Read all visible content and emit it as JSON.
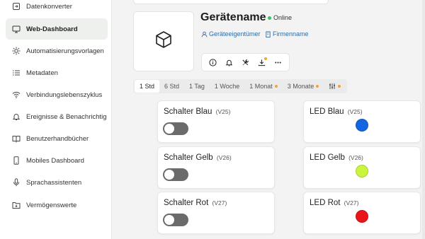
{
  "sidebar": {
    "items": [
      {
        "label": "Datenkonverter",
        "icon": "convert-icon",
        "active": false
      },
      {
        "label": "Web-Dashboard",
        "icon": "dashboard-icon",
        "active": true
      },
      {
        "label": "Automatisierungsvorlagen",
        "icon": "automation-icon",
        "active": false
      },
      {
        "label": "Metadaten",
        "icon": "list-icon",
        "active": false
      },
      {
        "label": "Verbindungslebenszyklus",
        "icon": "wifi-icon",
        "active": false
      },
      {
        "label": "Ereignisse & Benachrichtig",
        "icon": "bell-icon",
        "active": false
      },
      {
        "label": "Benutzerhandbücher",
        "icon": "book-icon",
        "active": false
      },
      {
        "label": "Mobiles Dashboard",
        "icon": "phone-icon",
        "active": false
      },
      {
        "label": "Sprachassistenten",
        "icon": "microphone-icon",
        "active": false
      },
      {
        "label": "Vermögenswerte",
        "icon": "folder-icon",
        "active": false
      }
    ]
  },
  "device": {
    "name": "Gerätename",
    "status": "Online",
    "owner_link": "Geräteeigentümer",
    "company_link": "Firmenname",
    "image_icon": "cube-icon"
  },
  "actions": [
    {
      "icon": "info-icon",
      "badge": false
    },
    {
      "icon": "bell-icon",
      "badge": false
    },
    {
      "icon": "tools-icon",
      "badge": false
    },
    {
      "icon": "download-icon",
      "badge": true
    },
    {
      "icon": "more-icon",
      "badge": false
    }
  ],
  "time_tabs": [
    {
      "label": "1 Std",
      "active": true,
      "dot": false
    },
    {
      "label": "6 Std",
      "active": false,
      "dot": false
    },
    {
      "label": "1 Tag",
      "active": false,
      "dot": false
    },
    {
      "label": "1 Woche",
      "active": false,
      "dot": false
    },
    {
      "label": "1 Monat",
      "active": false,
      "dot": true
    },
    {
      "label": "3 Monate",
      "active": false,
      "dot": true
    },
    {
      "label": "",
      "icon": "sliders-icon",
      "active": false,
      "dot": true
    }
  ],
  "widgets": {
    "switches": [
      {
        "title": "Schalter Blau",
        "pin": "(V25)",
        "state": "off"
      },
      {
        "title": "Schalter Gelb",
        "pin": "(V26)",
        "state": "off"
      },
      {
        "title": "Schalter Rot",
        "pin": "(V27)",
        "state": "off"
      }
    ],
    "leds": [
      {
        "title": "LED Blau",
        "pin": "(V25)",
        "color": "#1565e0"
      },
      {
        "title": "LED Gelb",
        "pin": "(V26)",
        "color": "#c9f53c"
      },
      {
        "title": "LED Rot",
        "pin": "(V27)",
        "color": "#e8151b"
      }
    ]
  },
  "colors": {
    "online": "#3bbf6a",
    "link": "#2e6ea8",
    "badge": "#f0a33a",
    "switch_off": "#6b6b6b"
  }
}
